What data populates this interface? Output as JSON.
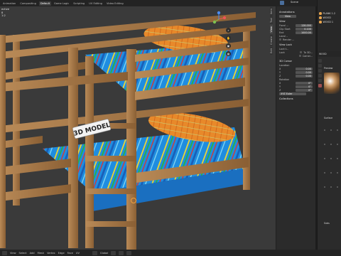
{
  "topbar": {
    "workspaces": [
      {
        "label": "Animation",
        "active": false
      },
      {
        "label": "Compositing",
        "active": false
      },
      {
        "label": "Default",
        "active": true
      },
      {
        "label": "Game Logic",
        "active": false
      },
      {
        "label": "Scripting",
        "active": false
      },
      {
        "label": "UV Editing",
        "active": false
      },
      {
        "label": "Video Editing",
        "active": false
      }
    ],
    "scene": "Scene"
  },
  "viewport": {
    "header_lines": [
      "ective",
      "8",
      "1:2"
    ],
    "sign_text": "3D MODEL"
  },
  "npanel": {
    "annotations": {
      "title": "Annotations",
      "view": "View"
    },
    "view": {
      "title": "View",
      "focal_label": "Focal ...",
      "focal_value": "128.000",
      "clip_start_label": "Clip Start",
      "clip_start_value": "0.100",
      "end_label": "End",
      "end_value": "1000.00",
      "local_label": "Local ..",
      "render_label": "Render ..."
    },
    "view_lock": {
      "title": "View Lock",
      "lock_to_label": "Lock t...",
      "lock_label": "Lock",
      "to_3d_label": "To 3D...",
      "camera_label": "Camer..."
    },
    "cursor_3d": {
      "title": "3D Cursor",
      "location_label": "Location",
      "x": "0.00",
      "y": "0.00",
      "z": "0.00",
      "rotation_label": "Rotation",
      "rx": "0°",
      "ry": "0°",
      "rz": "0°",
      "mode": "XYZ Euler"
    },
    "collections_title": "Collections"
  },
  "npanel_tabs": [
    "Item",
    "Tool",
    "View",
    "Create",
    "Edit"
  ],
  "outliner": {
    "items": [
      "PLANK 1.2",
      "WOOD",
      "WOOD 1"
    ]
  },
  "properties": {
    "header": "WOOD",
    "preview_label": "Preview",
    "surface_label": "Surface",
    "subsurface_label": "Subs"
  },
  "statusbar": {
    "items": [
      "View",
      "Select",
      "Add",
      "Mesh",
      "Vertex",
      "Edge",
      "Face",
      "UV",
      "Global"
    ],
    "colors": {
      "accent": "#f0a040"
    }
  }
}
